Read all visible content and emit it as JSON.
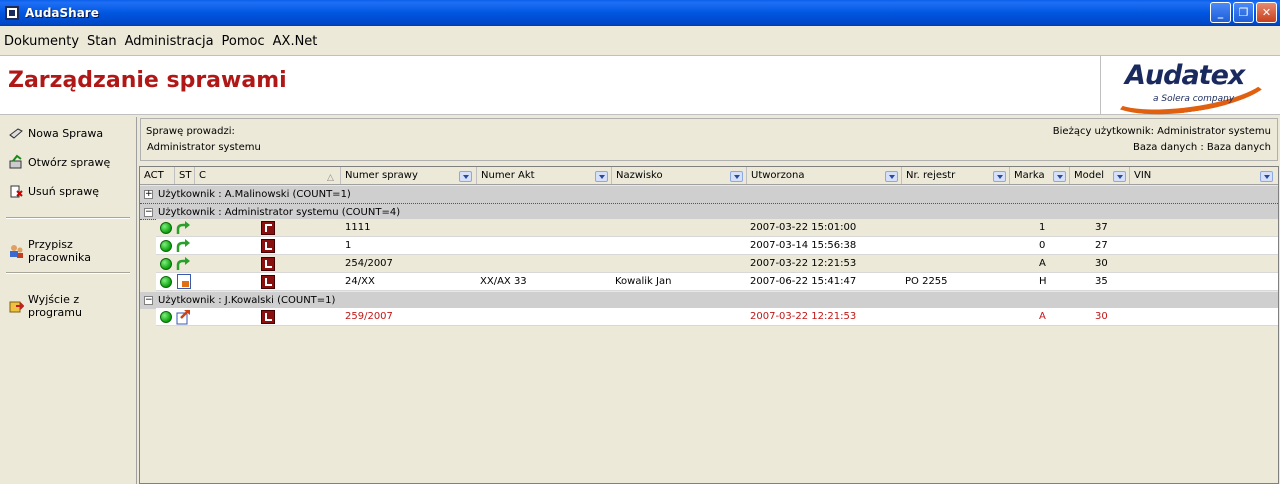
{
  "window": {
    "title": "AudaShare"
  },
  "menu": [
    "Dokumenty",
    "Stan",
    "Administracja",
    "Pomoc",
    "AX.Net"
  ],
  "banner": {
    "title": "Zarządzanie sprawami",
    "logo_main": "Audatex",
    "logo_sub": "a Solera company"
  },
  "sidebar": {
    "items": [
      {
        "label": "Nowa Sprawa",
        "icon": "new-case-icon"
      },
      {
        "label": "Otwórz sprawę",
        "icon": "open-case-icon"
      },
      {
        "label": "Usuń sprawę",
        "icon": "delete-case-icon"
      },
      {
        "label": "Przypisz pracownika",
        "icon": "assign-user-icon"
      },
      {
        "label": "Wyjście z programu",
        "icon": "exit-icon"
      }
    ]
  },
  "info": {
    "handler_label": "Sprawę prowadzi:",
    "handler_value": "Administrator systemu",
    "current_user": "Bieżący użytkownik: Administrator systemu",
    "database": "Baza danych : Baza danych"
  },
  "columns": [
    "ACT",
    "ST",
    "C",
    "Numer sprawy",
    "Numer Akt",
    "Nazwisko",
    "Utworzona",
    "Nr. rejestr",
    "Marka",
    "Model",
    "VIN"
  ],
  "groups": [
    {
      "label": "Użytkownik : A.Malinowski (COUNT=1)",
      "expander": "+"
    },
    {
      "label": "Użytkownik : Administrator systemu (COUNT=4)",
      "expander": "−"
    },
    {
      "label": "Użytkownik : J.Kowalski (COUNT=1)",
      "expander": "−"
    }
  ],
  "rows": [
    {
      "numer_sprawy": "1111",
      "numer_akt": "",
      "nazwisko": "",
      "utworzona": "2007-03-22 15:01:00",
      "nr_rejestr": "",
      "marka": "1",
      "model": "37",
      "vin": ""
    },
    {
      "numer_sprawy": "1",
      "numer_akt": "",
      "nazwisko": "",
      "utworzona": "2007-03-14 15:56:38",
      "nr_rejestr": "",
      "marka": "0",
      "model": "27",
      "vin": ""
    },
    {
      "numer_sprawy": "254/2007",
      "numer_akt": "",
      "nazwisko": "",
      "utworzona": "2007-03-22 12:21:53",
      "nr_rejestr": "",
      "marka": "A",
      "model": "30",
      "vin": ""
    },
    {
      "numer_sprawy": "24/XX",
      "numer_akt": "XX/AX 33",
      "nazwisko": "Kowalik Jan",
      "utworzona": "2007-06-22 15:41:47",
      "nr_rejestr": "PO 2255",
      "marka": "H",
      "model": "35",
      "vin": ""
    },
    {
      "numer_sprawy": "259/2007",
      "numer_akt": "",
      "nazwisko": "",
      "utworzona": "2007-03-22 12:21:53",
      "nr_rejestr": "",
      "marka": "A",
      "model": "30",
      "vin": ""
    }
  ],
  "colors": {
    "accent_red": "#b01818",
    "row_highlight_red": "#c01818",
    "titlebar_blue": "#0054e3"
  }
}
